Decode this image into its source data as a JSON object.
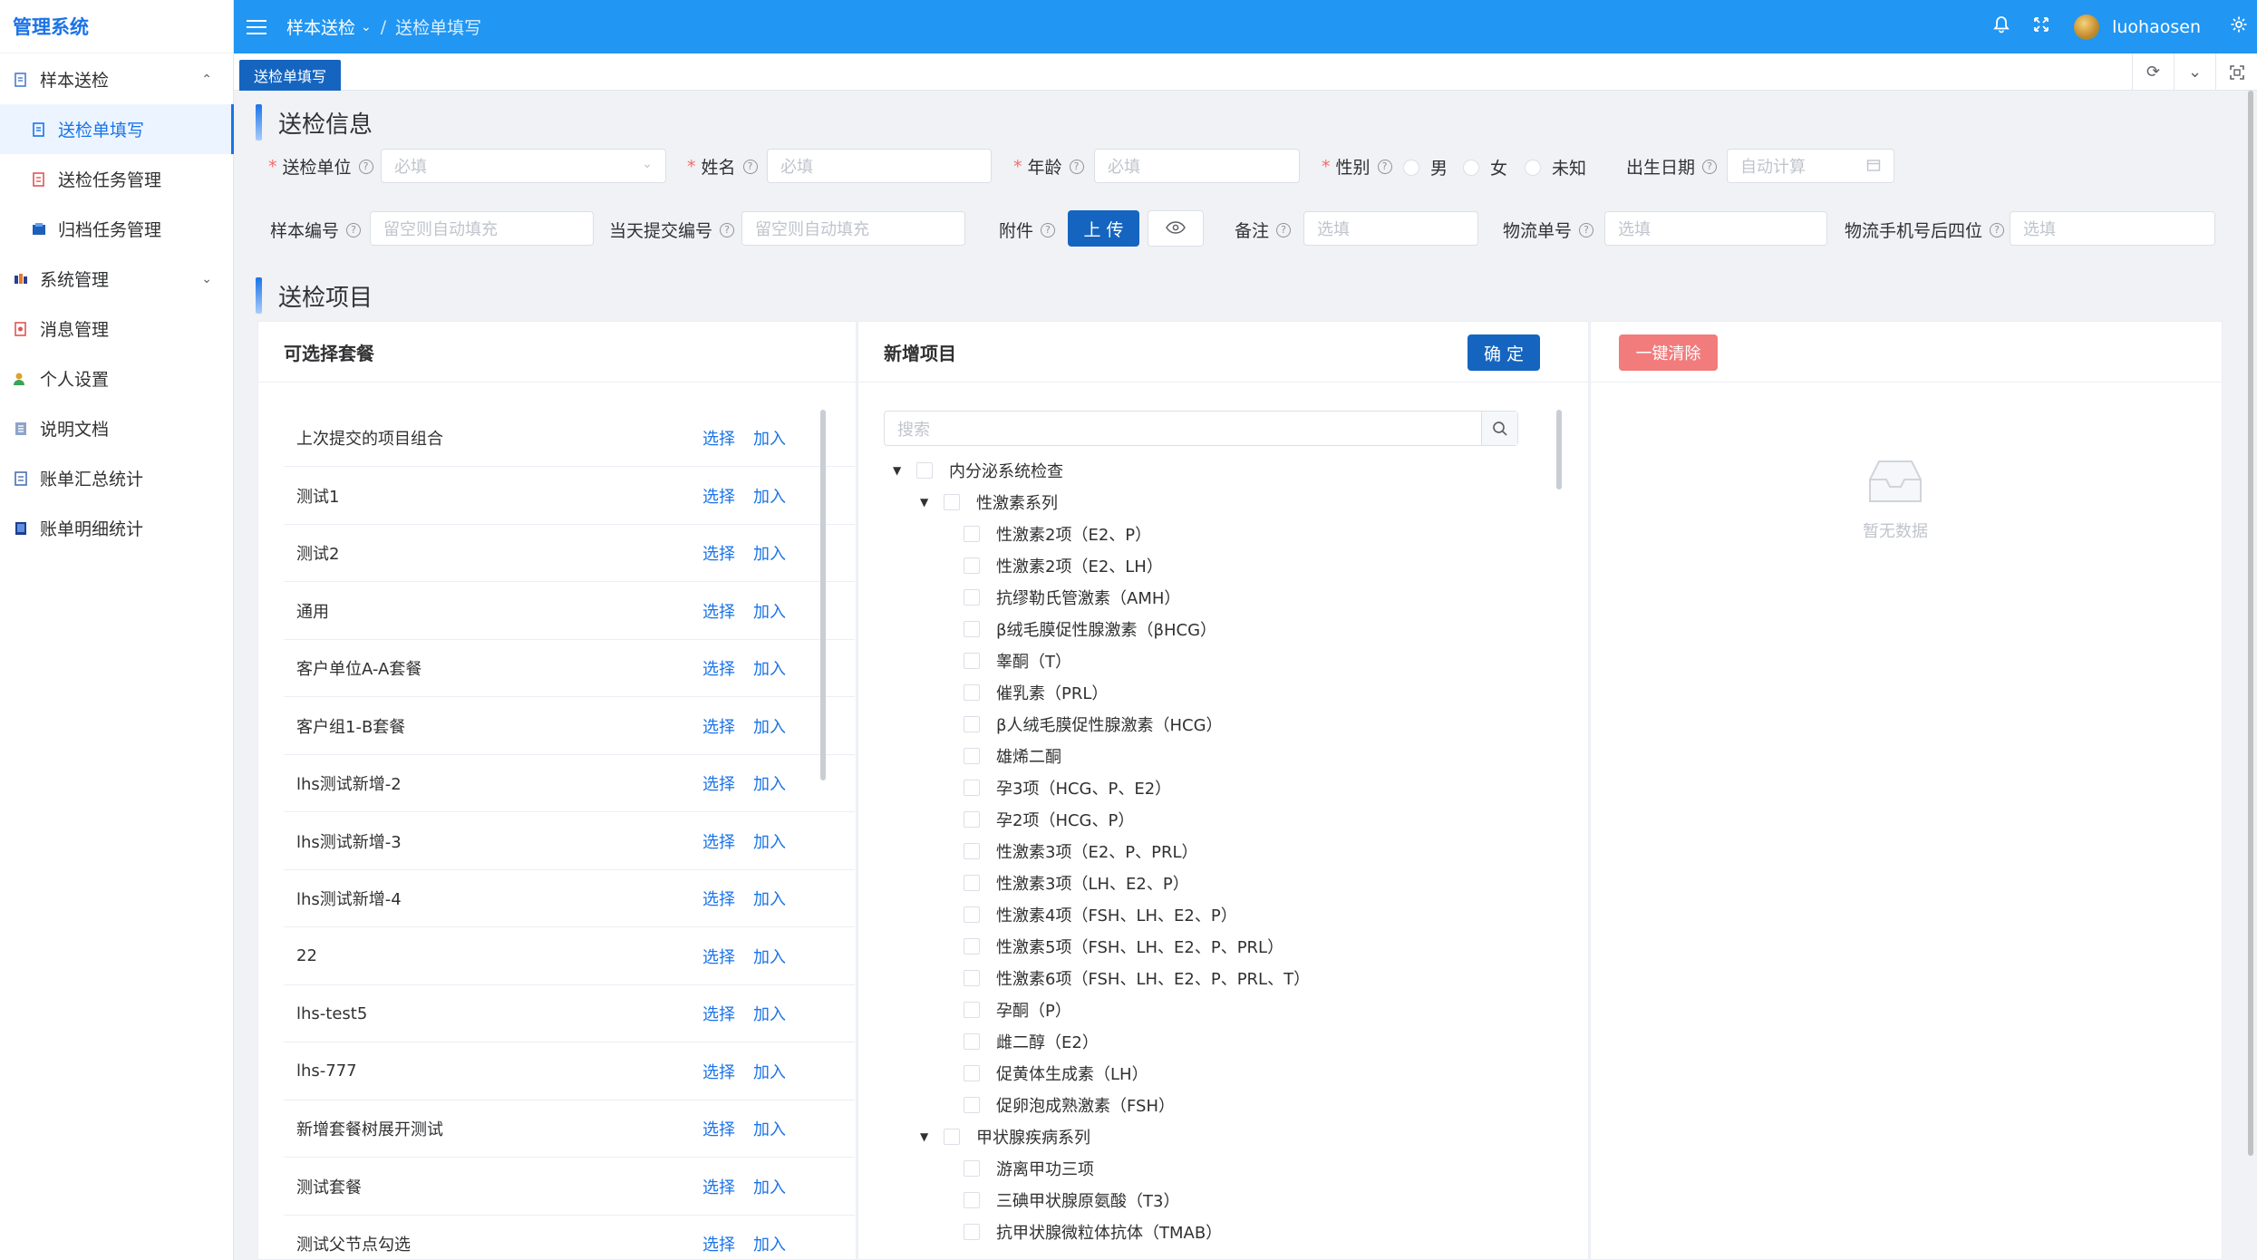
{
  "sidebar": {
    "logo": "管理系统",
    "items": [
      {
        "label": "样本送检",
        "arrow": "⌃"
      },
      {
        "label": "送检单填写"
      },
      {
        "label": "送检任务管理"
      },
      {
        "label": "归档任务管理"
      },
      {
        "label": "系统管理",
        "arrow": "⌄"
      },
      {
        "label": "消息管理"
      },
      {
        "label": "个人设置"
      },
      {
        "label": "说明文档"
      },
      {
        "label": "账单汇总统计"
      },
      {
        "label": "账单明细统计"
      }
    ]
  },
  "header": {
    "breadcrumb": [
      "样本送检",
      "送检单填写"
    ],
    "username": "luohaosen",
    "icons": [
      "bell-icon",
      "fullscreen-icon",
      "settings-icon"
    ]
  },
  "tabs": {
    "active": "送检单填写"
  },
  "form": {
    "section_title": "送检信息",
    "unit": {
      "label": "送检单位",
      "placeholder": "必填"
    },
    "name": {
      "label": "姓名",
      "placeholder": "必填"
    },
    "age": {
      "label": "年龄",
      "placeholder": "必填"
    },
    "gender": {
      "label": "性别",
      "options": [
        "男",
        "女",
        "未知"
      ]
    },
    "birthday": {
      "label": "出生日期",
      "placeholder": "自动计算"
    },
    "sample_no": {
      "label": "样本编号",
      "placeholder": "留空则自动填充"
    },
    "day_no": {
      "label": "当天提交编号",
      "placeholder": "留空则自动填充"
    },
    "attachment": {
      "label": "附件",
      "upload": "上 传"
    },
    "remark": {
      "label": "备注",
      "placeholder": "选填"
    },
    "logistics": {
      "label": "物流单号",
      "placeholder": "选填"
    },
    "phone": {
      "label": "物流手机号后四位",
      "placeholder": "选填"
    }
  },
  "items_section": {
    "title": "送检项目",
    "combos": {
      "title": "可选择套餐",
      "select_label": "选择",
      "add_label": "加入",
      "rows": [
        "上次提交的项目组合",
        "测试1",
        "测试2",
        "通用",
        "客户单位A-A套餐",
        "客户组1-B套餐",
        "lhs测试新增-2",
        "lhs测试新增-3",
        "lhs测试新增-4",
        "22",
        "lhs-test5",
        "lhs-777",
        "新增套餐树展开测试",
        "测试套餐",
        "测试父节点勾选"
      ]
    },
    "new_items": {
      "title": "新增项目",
      "confirm": "确 定",
      "search_placeholder": "搜索",
      "tree": [
        {
          "label": "内分泌系统检查",
          "level": 0,
          "caret": true
        },
        {
          "label": "性激素系列",
          "level": 1,
          "caret": true
        },
        {
          "label": "性激素2项（E2、P）",
          "level": 2
        },
        {
          "label": "性激素2项（E2、LH）",
          "level": 2
        },
        {
          "label": "抗缪勒氏管激素（AMH）",
          "level": 2
        },
        {
          "label": "β绒毛膜促性腺激素（βHCG）",
          "level": 2
        },
        {
          "label": "睾酮（T）",
          "level": 2
        },
        {
          "label": "催乳素（PRL）",
          "level": 2
        },
        {
          "label": "β人绒毛膜促性腺激素（HCG）",
          "level": 2
        },
        {
          "label": "雄烯二酮",
          "level": 2
        },
        {
          "label": "孕3项（HCG、P、E2）",
          "level": 2
        },
        {
          "label": "孕2项（HCG、P）",
          "level": 2
        },
        {
          "label": "性激素3项（E2、P、PRL）",
          "level": 2
        },
        {
          "label": "性激素3项（LH、E2、P）",
          "level": 2
        },
        {
          "label": "性激素4项（FSH、LH、E2、P）",
          "level": 2
        },
        {
          "label": "性激素5项（FSH、LH、E2、P、PRL）",
          "level": 2
        },
        {
          "label": "性激素6项（FSH、LH、E2、P、PRL、T）",
          "level": 2
        },
        {
          "label": "孕酮（P）",
          "level": 2
        },
        {
          "label": "雌二醇（E2）",
          "level": 2
        },
        {
          "label": "促黄体生成素（LH）",
          "level": 2
        },
        {
          "label": "促卵泡成熟激素（FSH）",
          "level": 2
        },
        {
          "label": "甲状腺疾病系列",
          "level": 1,
          "caret": true
        },
        {
          "label": "游离甲功三项",
          "level": 2
        },
        {
          "label": "三碘甲状腺原氨酸（T3）",
          "level": 2
        },
        {
          "label": "抗甲状腺微粒体抗体（TMAB）",
          "level": 2
        }
      ]
    },
    "selected": {
      "clear": "一键清除",
      "empty": "暂无数据"
    }
  }
}
